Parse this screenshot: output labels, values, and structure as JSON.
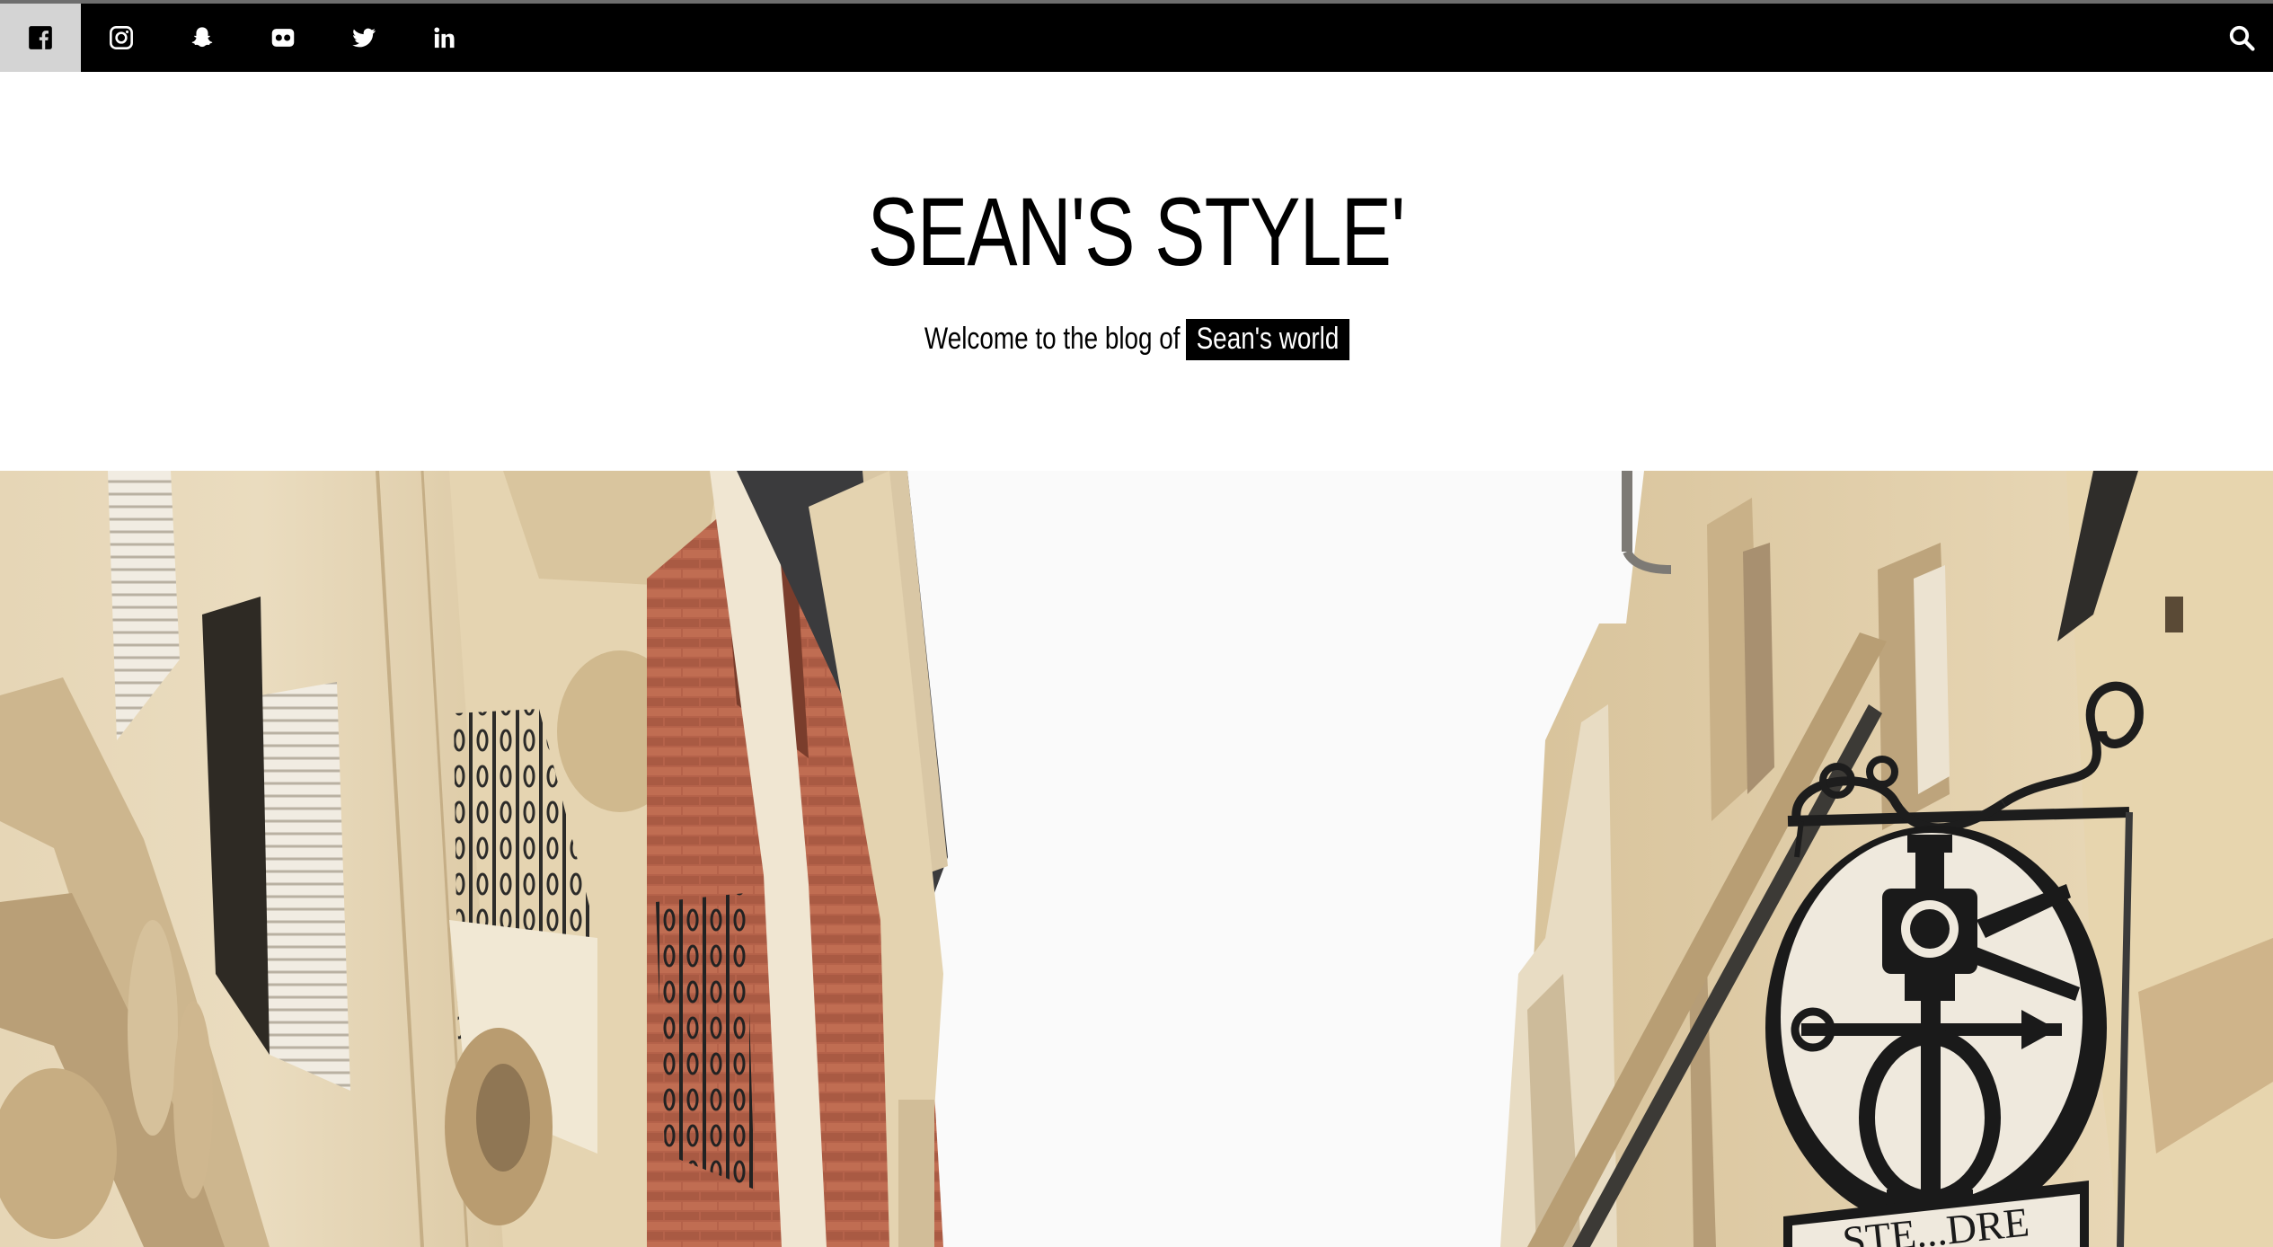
{
  "social_bar": {
    "items": [
      {
        "icon": "facebook-icon",
        "label": "Facebook",
        "active": true
      },
      {
        "icon": "instagram-icon",
        "label": "Instagram",
        "active": false
      },
      {
        "icon": "snapchat-icon",
        "label": "Snapchat",
        "active": false
      },
      {
        "icon": "flickr-icon",
        "label": "Flickr",
        "active": false
      },
      {
        "icon": "twitter-icon",
        "label": "Twitter",
        "active": false
      },
      {
        "icon": "linkedin-icon",
        "label": "LinkedIn",
        "active": false
      }
    ],
    "search_icon": "search-icon"
  },
  "header": {
    "title": "SEAN'S STYLE'",
    "tagline_prefix": "Welcome to the blog of",
    "tagline_highlight": "Sean's world"
  },
  "hero": {
    "sign_text": "STE...DRE"
  },
  "colors": {
    "bar_background": "#000000",
    "active_social_background": "#d4d4d4",
    "highlight_background": "#000000",
    "highlight_text": "#ffffff"
  }
}
